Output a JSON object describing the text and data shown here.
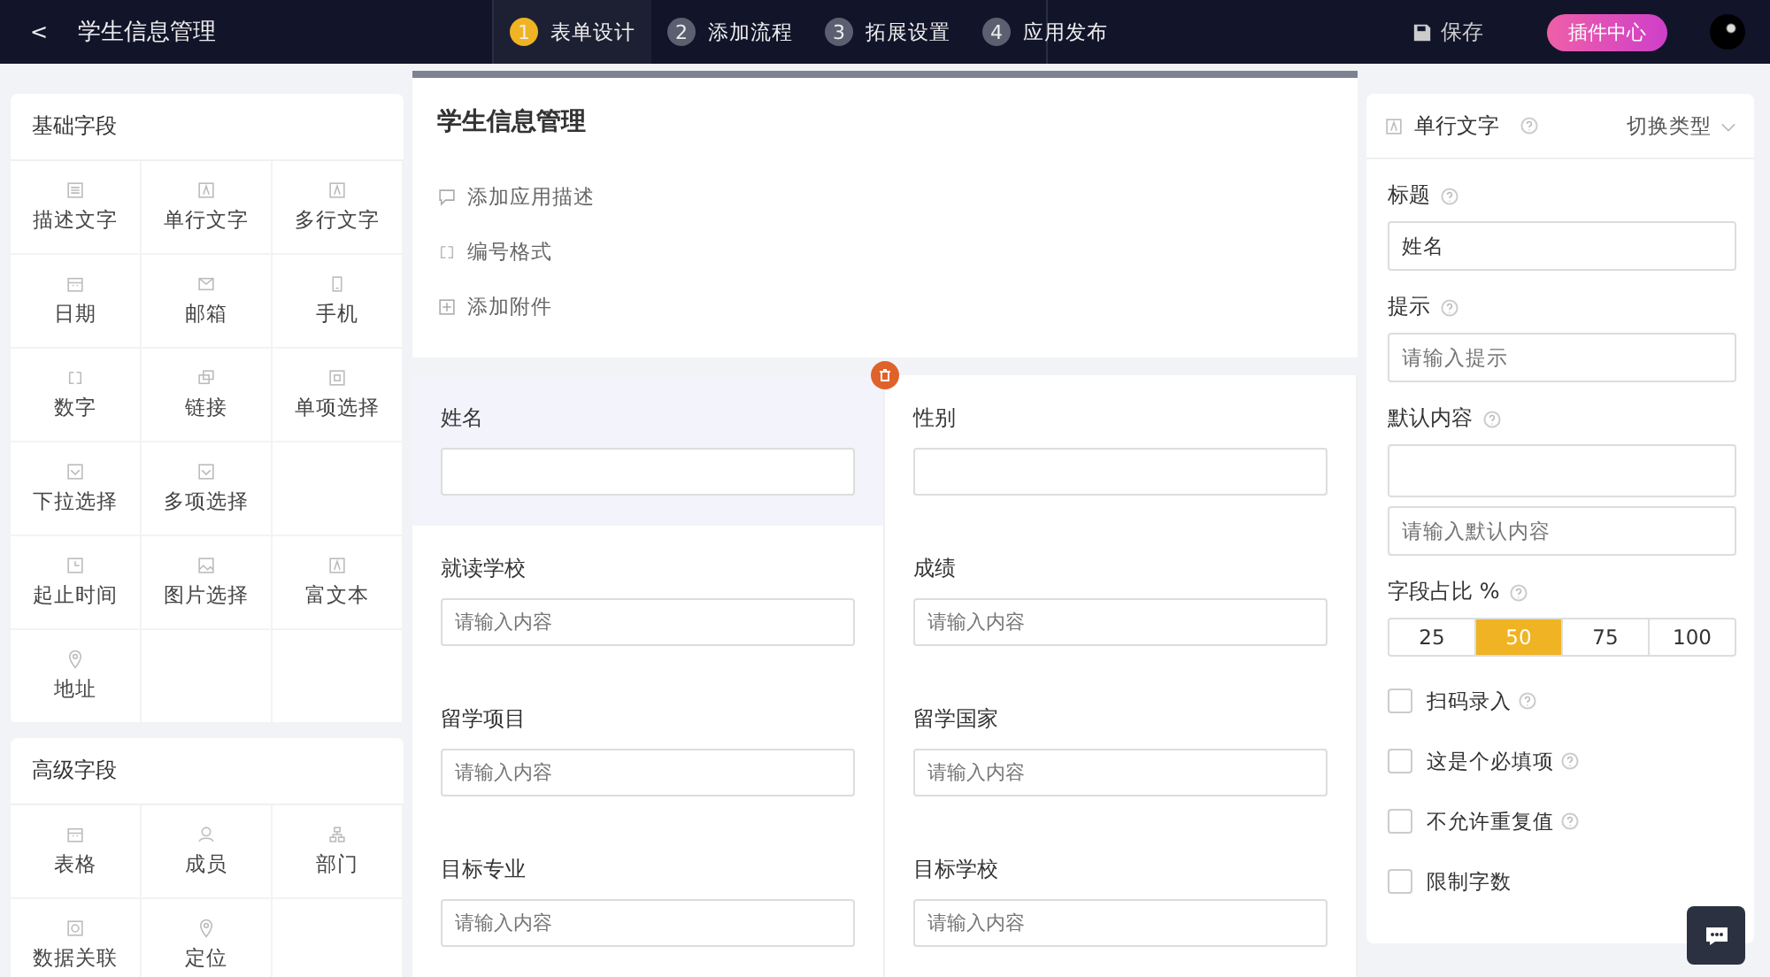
{
  "topbar": {
    "back": "<",
    "title": "学生信息管理",
    "steps": [
      {
        "number": "1",
        "label": "表单设计",
        "selected": true
      },
      {
        "number": "2",
        "label": "添加流程",
        "selected": false
      },
      {
        "number": "3",
        "label": "拓展设置",
        "selected": false
      },
      {
        "number": "4",
        "label": "应用发布",
        "selected": false
      }
    ],
    "save": "保存",
    "plugin": "插件中心"
  },
  "palette": [
    {
      "title": "基础字段",
      "items": [
        {
          "label": "描述文字",
          "kind": "lines"
        },
        {
          "label": "单行文字",
          "kind": "text"
        },
        {
          "label": "多行文字",
          "kind": "text"
        },
        {
          "label": "日期",
          "kind": "calendar"
        },
        {
          "label": "邮箱",
          "kind": "mail"
        },
        {
          "label": "手机",
          "kind": "phone"
        },
        {
          "label": "数字",
          "kind": "number"
        },
        {
          "label": "链接",
          "kind": "link"
        },
        {
          "label": "单项选择",
          "kind": "radio"
        },
        {
          "label": "下拉选择",
          "kind": "select"
        },
        {
          "label": "多项选择",
          "kind": "select"
        },
        {
          "kind": "blank"
        },
        {
          "label": "起止时间",
          "kind": "clock"
        },
        {
          "label": "图片选择",
          "kind": "image"
        },
        {
          "label": "富文本",
          "kind": "text"
        },
        {
          "label": "地址",
          "kind": "pin"
        }
      ]
    },
    {
      "title": "高级字段",
      "items": [
        {
          "label": "表格",
          "kind": "calendar"
        },
        {
          "label": "成员",
          "kind": "person"
        },
        {
          "label": "部门",
          "kind": "org"
        },
        {
          "label": "数据关联",
          "kind": "search"
        },
        {
          "label": "定位",
          "kind": "pin"
        }
      ]
    }
  ],
  "form": {
    "title": "学生信息管理",
    "actions": [
      {
        "label": "添加应用描述",
        "kind": "comment"
      },
      {
        "label": "编号格式",
        "kind": "number"
      },
      {
        "label": "添加附件",
        "kind": "attach"
      }
    ],
    "fields": [
      {
        "label": "姓名",
        "selected": true
      },
      {
        "label": "性别",
        "selected": false
      },
      {
        "label": "就读学校",
        "placeholder": "请输入内容",
        "selected": false
      },
      {
        "label": "成绩",
        "placeholder": "请输入内容",
        "selected": false
      },
      {
        "label": "留学项目",
        "placeholder": "请输入内容",
        "selected": false
      },
      {
        "label": "留学国家",
        "placeholder": "请输入内容",
        "selected": false
      },
      {
        "label": "目标专业",
        "placeholder": "请输入内容",
        "selected": false
      },
      {
        "label": "目标学校",
        "placeholder": "请输入内容",
        "selected": false
      }
    ]
  },
  "settings": {
    "type": "单行文字",
    "switch": "切换类型",
    "title_label": "标题",
    "title_value": "姓名",
    "hint_label": "提示",
    "hint_placeholder": "请输入提示",
    "default_label": "默认内容",
    "default_placeholder": "请输入默认内容",
    "ratio_label": "字段占比 %",
    "ratios": [
      {
        "label": "25",
        "selected": false
      },
      {
        "label": "50",
        "selected": true
      },
      {
        "label": "75",
        "selected": false
      },
      {
        "label": "100",
        "selected": false
      }
    ],
    "options": [
      {
        "label": "扫码录入",
        "checked": false,
        "help": true
      },
      {
        "label": "这是个必填项",
        "checked": false,
        "help": true
      },
      {
        "label": "不允许重复值",
        "checked": false,
        "help": true
      },
      {
        "label": "限制字数",
        "checked": false,
        "help": false
      }
    ]
  }
}
